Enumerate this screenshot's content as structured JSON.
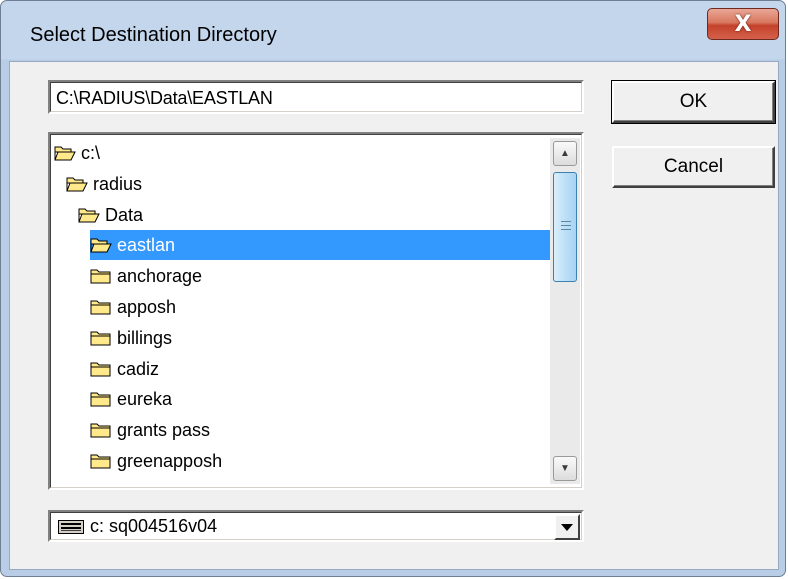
{
  "window": {
    "title": "Select Destination Directory",
    "close_label": "X"
  },
  "path": {
    "value": "C:\\RADIUS\\Data\\EASTLAN"
  },
  "buttons": {
    "ok_label": "OK",
    "cancel_label": "Cancel"
  },
  "directories": [
    {
      "label": "c:\\",
      "open": true,
      "selected": false
    },
    {
      "label": "radius",
      "open": true,
      "selected": false
    },
    {
      "label": "Data",
      "open": true,
      "selected": false
    },
    {
      "label": "eastlan",
      "open": true,
      "selected": true
    },
    {
      "label": "anchorage",
      "open": false,
      "selected": false
    },
    {
      "label": "apposh",
      "open": false,
      "selected": false
    },
    {
      "label": "billings",
      "open": false,
      "selected": false
    },
    {
      "label": "cadiz",
      "open": false,
      "selected": false
    },
    {
      "label": "eureka",
      "open": false,
      "selected": false
    },
    {
      "label": "grants pass",
      "open": false,
      "selected": false
    },
    {
      "label": "greenapposh",
      "open": false,
      "selected": false
    }
  ],
  "drive": {
    "value": "c:  sq004516v04",
    "icon": "drive-icon"
  },
  "colors": {
    "selection": "#3399ff",
    "folder_fill": "#ffe98a",
    "close_button": "#c4412b"
  }
}
